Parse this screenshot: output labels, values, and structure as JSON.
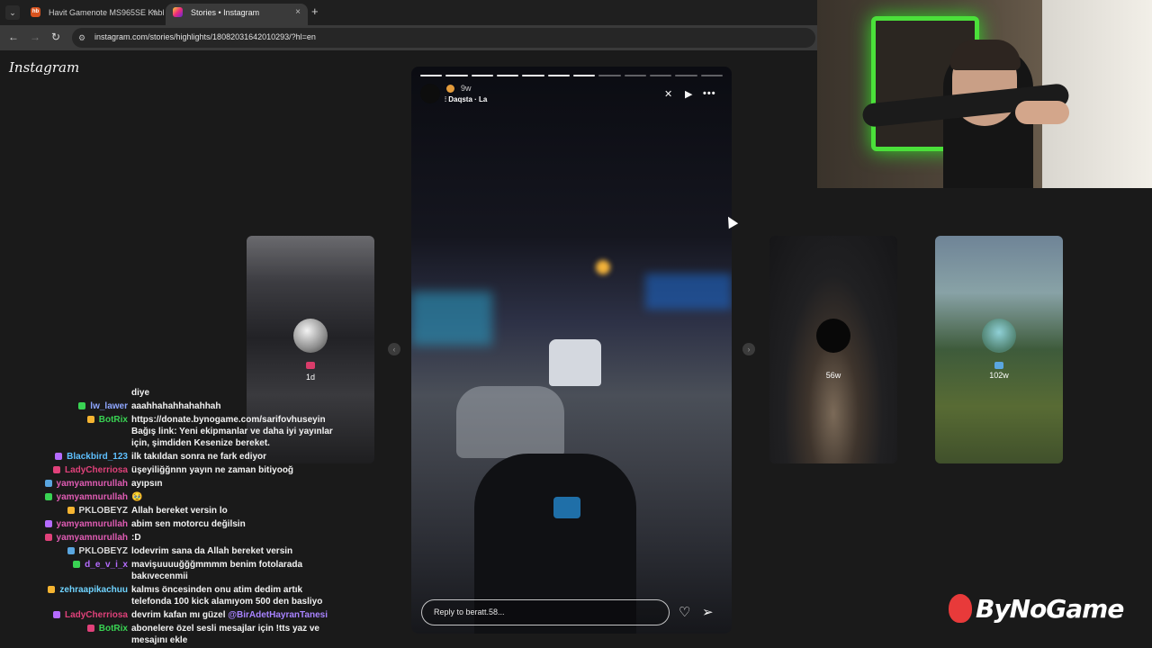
{
  "browser": {
    "tabs": [
      {
        "favicon": "hb",
        "title": "Havit Gamenote MS965SE Kabl",
        "active": false
      },
      {
        "favicon": "ig",
        "title": "Stories • Instagram",
        "active": true
      }
    ],
    "menu_icon": "chevron-down-icon",
    "close_icon": "×",
    "new_tab": "+",
    "url": "instagram.com/stories/highlights/18082031642010293/?hl=en"
  },
  "instagram": {
    "logo": "Instagram",
    "story": {
      "time": "9w",
      "audio": "Daqsta · La",
      "progress_total": 12,
      "progress_done": 7,
      "reply_placeholder": "Reply to beratt.58..."
    },
    "side_stories": [
      {
        "time": "1d"
      },
      {
        "time": "56w"
      },
      {
        "time": "102w"
      }
    ]
  },
  "chat": {
    "messages": [
      {
        "user": "",
        "user_color": "#f2f2f2",
        "text": "diye"
      },
      {
        "user": "lw_lawer",
        "user_color": "#8ea6ff",
        "text": "aaahhahahhahahhah"
      },
      {
        "user": "BotRix",
        "user_color": "#39d353",
        "text": "https://donate.bynogame.com/sarifovhuseyin Bağış link: Yeni ekipmanlar ve daha iyi yayınlar için, şimdiden Kesenize bereket."
      },
      {
        "user": "Blackbird_123",
        "user_color": "#5ec0ff",
        "text": "ilk takıldan sonra ne fark ediyor"
      },
      {
        "user": "LadyCherriosa",
        "user_color": "#e0417a",
        "text": "üşeyiliğğnnn yayın ne zaman bitiyooğ"
      },
      {
        "user": "yamyamnurullah",
        "user_color": "#e05cb4",
        "text": "ayıpsın"
      },
      {
        "user": "yamyamnurullah",
        "user_color": "#e05cb4",
        "text": "🥹"
      },
      {
        "user": "PKLOBEYZ",
        "user_color": "#d9d9d9",
        "text": "Allah bereket versin lo"
      },
      {
        "user": "yamyamnurullah",
        "user_color": "#e05cb4",
        "text": "abim sen motorcu değilsin"
      },
      {
        "user": "yamyamnurullah",
        "user_color": "#e05cb4",
        "text": ":D"
      },
      {
        "user": "PKLOBEYZ",
        "user_color": "#d9d9d9",
        "text": "lodevrim sana da Allah bereket versin"
      },
      {
        "user": "d_e_v_i_x",
        "user_color": "#b56bff",
        "text": "mavişuuuuğğğmmmm benim fotolarada bakıvecenmii"
      },
      {
        "user": "zehraapikachuu",
        "user_color": "#6fd3ff",
        "text": "kalmıs öncesinden onu atim dedim artık telefonda 100 kick alamıyom 500 den basliyo"
      },
      {
        "user": "LadyCherriosa",
        "user_color": "#e0417a",
        "text": "devrim kafan mı güzel ",
        "mention": "@BirAdetHayranTanesi"
      },
      {
        "user": "BotRix",
        "user_color": "#39d353",
        "text": "abonelere özel sesli mesajlar için !tts yaz ve mesajını ekle"
      }
    ]
  },
  "overlay": {
    "brand": "ByNoGame",
    "brand_color": "#e83a3a"
  },
  "colors": {
    "page_bg": "#1a1a1a",
    "chrome_bg": "#1f1f1f",
    "address_bg": "#3a3a3a",
    "webcam_glow": "#4be03a"
  }
}
